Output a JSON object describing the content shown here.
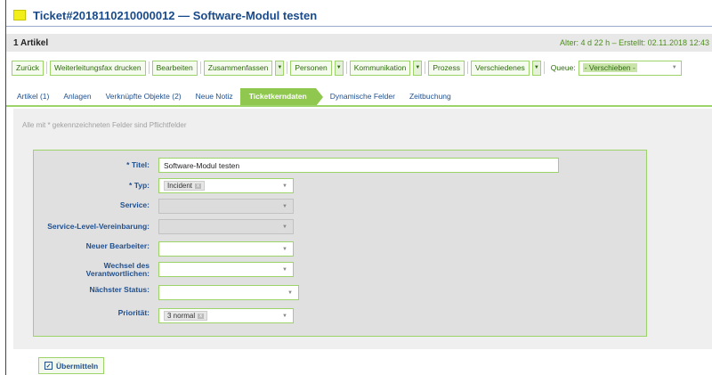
{
  "title": "Ticket#2018110210000012 — Software-Modul testen",
  "artikel_bar": {
    "count": "1 Artikel",
    "meta": "Alter: 4 d 22 h – Erstellt: 02.11.2018 12:43"
  },
  "toolbar": {
    "zurueck": "Zurück",
    "weiterleitungsfax": "Weiterleitungsfax drucken",
    "bearbeiten": "Bearbeiten",
    "zusammenfassen": "Zusammenfassen",
    "personen": "Personen",
    "kommunikation": "Kommunikation",
    "prozess": "Prozess",
    "verschiedenes": "Verschiedenes",
    "queue_label": "Queue:",
    "queue_value": "- Verschieben -"
  },
  "tabs": [
    {
      "label": "Artikel (1)",
      "active": false
    },
    {
      "label": "Anlagen",
      "active": false
    },
    {
      "label": "Verknüpfte Objekte (2)",
      "active": false
    },
    {
      "label": "Neue Notiz",
      "active": false
    },
    {
      "label": "Ticketkerndaten",
      "active": true
    },
    {
      "label": "Dynamische Felder",
      "active": false
    },
    {
      "label": "Zeitbuchung",
      "active": false
    }
  ],
  "required_note": "Alle mit * gekennzeichneten Felder sind Pflichtfelder",
  "form": {
    "titel_label": "Titel:",
    "titel_value": "Software-Modul testen",
    "typ_label": "Typ:",
    "typ_value": "Incident",
    "service_label": "Service:",
    "slv_label": "Service-Level-Vereinbarung:",
    "bearbeiter_label": "Neuer Bearbeiter:",
    "verantwortlicher_label_1": "Wechsel des",
    "verantwortlicher_label_2": "Verantwortlichen:",
    "status_label": "Nächster Status:",
    "prioritaet_label": "Priorität:",
    "prioritaet_value": "3 normal",
    "required_marker": "*",
    "chip_remove": "x"
  },
  "submit_label": "Übermitteln",
  "colors": {
    "accent_green": "#90c84f",
    "link_blue": "#1f4f8f",
    "title_blue": "#1a4a8a",
    "title_square": "#f1ee1a"
  }
}
